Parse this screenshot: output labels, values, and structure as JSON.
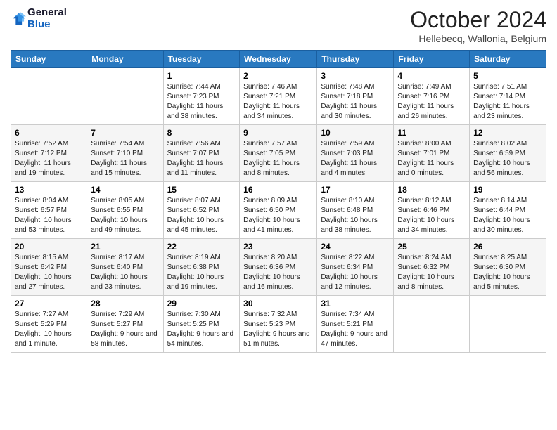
{
  "logo": {
    "line1": "General",
    "line2": "Blue"
  },
  "title": "October 2024",
  "location": "Hellebecq, Wallonia, Belgium",
  "weekdays": [
    "Sunday",
    "Monday",
    "Tuesday",
    "Wednesday",
    "Thursday",
    "Friday",
    "Saturday"
  ],
  "weeks": [
    [
      {
        "day": "",
        "info": ""
      },
      {
        "day": "",
        "info": ""
      },
      {
        "day": "1",
        "info": "Sunrise: 7:44 AM\nSunset: 7:23 PM\nDaylight: 11 hours and 38 minutes."
      },
      {
        "day": "2",
        "info": "Sunrise: 7:46 AM\nSunset: 7:21 PM\nDaylight: 11 hours and 34 minutes."
      },
      {
        "day": "3",
        "info": "Sunrise: 7:48 AM\nSunset: 7:18 PM\nDaylight: 11 hours and 30 minutes."
      },
      {
        "day": "4",
        "info": "Sunrise: 7:49 AM\nSunset: 7:16 PM\nDaylight: 11 hours and 26 minutes."
      },
      {
        "day": "5",
        "info": "Sunrise: 7:51 AM\nSunset: 7:14 PM\nDaylight: 11 hours and 23 minutes."
      }
    ],
    [
      {
        "day": "6",
        "info": "Sunrise: 7:52 AM\nSunset: 7:12 PM\nDaylight: 11 hours and 19 minutes."
      },
      {
        "day": "7",
        "info": "Sunrise: 7:54 AM\nSunset: 7:10 PM\nDaylight: 11 hours and 15 minutes."
      },
      {
        "day": "8",
        "info": "Sunrise: 7:56 AM\nSunset: 7:07 PM\nDaylight: 11 hours and 11 minutes."
      },
      {
        "day": "9",
        "info": "Sunrise: 7:57 AM\nSunset: 7:05 PM\nDaylight: 11 hours and 8 minutes."
      },
      {
        "day": "10",
        "info": "Sunrise: 7:59 AM\nSunset: 7:03 PM\nDaylight: 11 hours and 4 minutes."
      },
      {
        "day": "11",
        "info": "Sunrise: 8:00 AM\nSunset: 7:01 PM\nDaylight: 11 hours and 0 minutes."
      },
      {
        "day": "12",
        "info": "Sunrise: 8:02 AM\nSunset: 6:59 PM\nDaylight: 10 hours and 56 minutes."
      }
    ],
    [
      {
        "day": "13",
        "info": "Sunrise: 8:04 AM\nSunset: 6:57 PM\nDaylight: 10 hours and 53 minutes."
      },
      {
        "day": "14",
        "info": "Sunrise: 8:05 AM\nSunset: 6:55 PM\nDaylight: 10 hours and 49 minutes."
      },
      {
        "day": "15",
        "info": "Sunrise: 8:07 AM\nSunset: 6:52 PM\nDaylight: 10 hours and 45 minutes."
      },
      {
        "day": "16",
        "info": "Sunrise: 8:09 AM\nSunset: 6:50 PM\nDaylight: 10 hours and 41 minutes."
      },
      {
        "day": "17",
        "info": "Sunrise: 8:10 AM\nSunset: 6:48 PM\nDaylight: 10 hours and 38 minutes."
      },
      {
        "day": "18",
        "info": "Sunrise: 8:12 AM\nSunset: 6:46 PM\nDaylight: 10 hours and 34 minutes."
      },
      {
        "day": "19",
        "info": "Sunrise: 8:14 AM\nSunset: 6:44 PM\nDaylight: 10 hours and 30 minutes."
      }
    ],
    [
      {
        "day": "20",
        "info": "Sunrise: 8:15 AM\nSunset: 6:42 PM\nDaylight: 10 hours and 27 minutes."
      },
      {
        "day": "21",
        "info": "Sunrise: 8:17 AM\nSunset: 6:40 PM\nDaylight: 10 hours and 23 minutes."
      },
      {
        "day": "22",
        "info": "Sunrise: 8:19 AM\nSunset: 6:38 PM\nDaylight: 10 hours and 19 minutes."
      },
      {
        "day": "23",
        "info": "Sunrise: 8:20 AM\nSunset: 6:36 PM\nDaylight: 10 hours and 16 minutes."
      },
      {
        "day": "24",
        "info": "Sunrise: 8:22 AM\nSunset: 6:34 PM\nDaylight: 10 hours and 12 minutes."
      },
      {
        "day": "25",
        "info": "Sunrise: 8:24 AM\nSunset: 6:32 PM\nDaylight: 10 hours and 8 minutes."
      },
      {
        "day": "26",
        "info": "Sunrise: 8:25 AM\nSunset: 6:30 PM\nDaylight: 10 hours and 5 minutes."
      }
    ],
    [
      {
        "day": "27",
        "info": "Sunrise: 7:27 AM\nSunset: 5:29 PM\nDaylight: 10 hours and 1 minute."
      },
      {
        "day": "28",
        "info": "Sunrise: 7:29 AM\nSunset: 5:27 PM\nDaylight: 9 hours and 58 minutes."
      },
      {
        "day": "29",
        "info": "Sunrise: 7:30 AM\nSunset: 5:25 PM\nDaylight: 9 hours and 54 minutes."
      },
      {
        "day": "30",
        "info": "Sunrise: 7:32 AM\nSunset: 5:23 PM\nDaylight: 9 hours and 51 minutes."
      },
      {
        "day": "31",
        "info": "Sunrise: 7:34 AM\nSunset: 5:21 PM\nDaylight: 9 hours and 47 minutes."
      },
      {
        "day": "",
        "info": ""
      },
      {
        "day": "",
        "info": ""
      }
    ]
  ]
}
